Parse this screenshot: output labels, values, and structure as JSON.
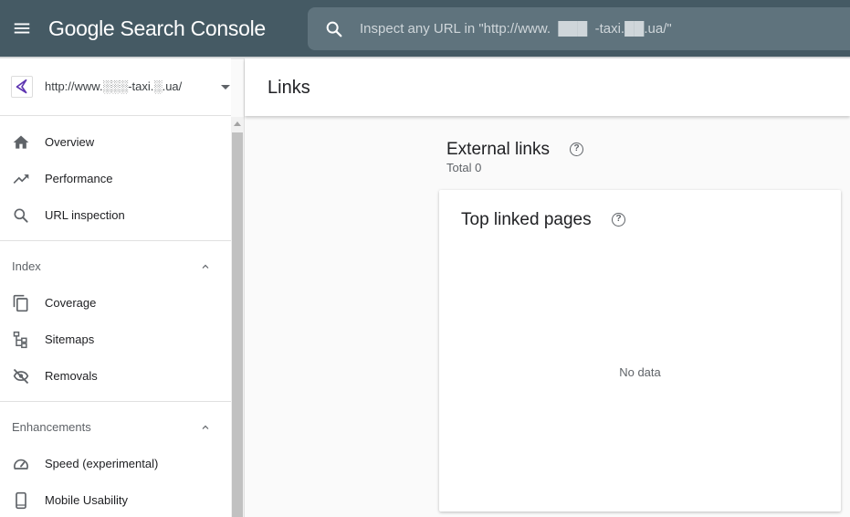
{
  "app": {
    "logo": "Google Search Console"
  },
  "search": {
    "placeholder": "Inspect any URL in \"http://www.  ███  -taxi.██.ua/\""
  },
  "property": {
    "url": "http://www.░░░-taxi.░.ua/"
  },
  "nav": {
    "overview": "Overview",
    "performance": "Performance",
    "url_inspection": "URL inspection",
    "index_section": "Index",
    "coverage": "Coverage",
    "sitemaps": "Sitemaps",
    "removals": "Removals",
    "enhancements_section": "Enhancements",
    "speed": "Speed (experimental)",
    "mobile_usability": "Mobile Usability"
  },
  "page": {
    "title": "Links"
  },
  "external_links": {
    "title": "External links",
    "total": "Total 0"
  },
  "top_linked_pages": {
    "title": "Top linked pages",
    "empty": "No data"
  },
  "icons": {
    "menu": "hamburger-menu-icon",
    "search": "search-icon",
    "property": "property-arrow-icon",
    "overview": "home-icon",
    "performance": "trending-up-icon",
    "url_inspection": "search-icon",
    "coverage": "copy-pages-icon",
    "sitemaps": "sitemap-icon",
    "removals": "eye-off-icon",
    "speed": "speedometer-icon",
    "mobile_usability": "smartphone-icon",
    "help": "help-circle-icon"
  },
  "colors": {
    "topbar": "#455a64",
    "search_bg": "#5f737d",
    "property_accent": "#5e35b1"
  }
}
